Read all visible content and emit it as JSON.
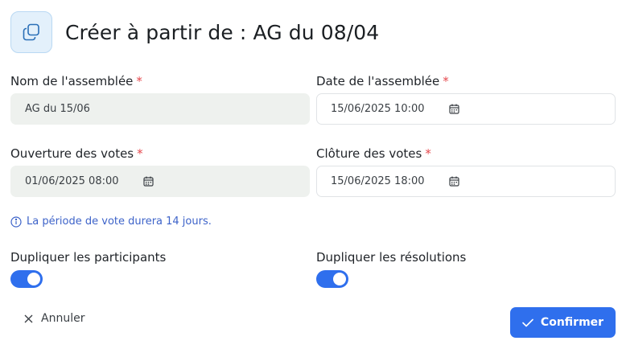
{
  "header": {
    "icon": "duplicate-icon",
    "title": "Créer à partir de : AG du 08/04"
  },
  "form": {
    "name": {
      "label": "Nom de l'assemblée",
      "required_mark": "*",
      "value": "AG du 15/06"
    },
    "date": {
      "label": "Date de l'assemblée",
      "required_mark": "*",
      "value": "15/06/2025 10:00",
      "icon": "calendar-icon"
    },
    "opening": {
      "label": "Ouverture des votes",
      "required_mark": "*",
      "value": "01/06/2025 08:00",
      "icon": "calendar-icon"
    },
    "closing": {
      "label": "Clôture des votes",
      "required_mark": "*",
      "value": "15/06/2025 18:00",
      "icon": "calendar-icon"
    }
  },
  "info": {
    "icon": "info-icon",
    "text": "La période de vote durera 14 jours."
  },
  "toggles": {
    "participants": {
      "label": "Dupliquer les participants",
      "checked": true
    },
    "resolutions": {
      "label": "Dupliquer les résolutions",
      "checked": true
    }
  },
  "actions": {
    "cancel": {
      "label": "Annuler",
      "icon": "close-icon"
    },
    "confirm": {
      "label": "Confirmer",
      "icon": "check-icon"
    }
  },
  "colors": {
    "accent": "#2f6fed",
    "required": "#e5484d",
    "info": "#3d63c9",
    "header_icon_bg": "#e3f0fb"
  }
}
